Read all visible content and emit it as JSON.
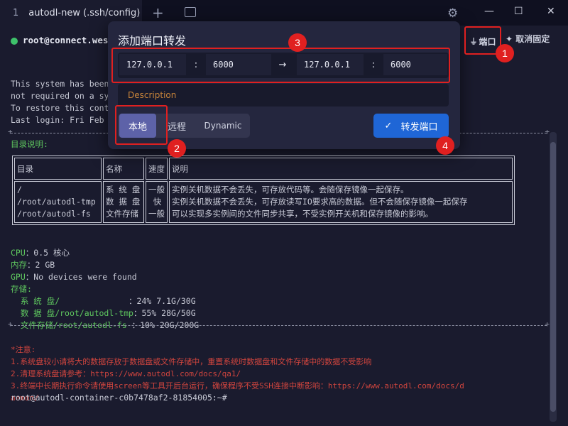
{
  "window": {
    "tab_number": "1",
    "tab_title": "autodl-new (.ssh/config)",
    "add_tab": "+",
    "minimize": "—",
    "maximize": "☐",
    "close": "✕"
  },
  "header": {
    "host": "root@connect.west",
    "port_label": "端口",
    "unpin_label": "取消固定"
  },
  "terminal": {
    "lines_top": [
      "This system has been",
      "not required on a sy",
      "",
      "To restore this cont",
      "Last login: Fri Feb"
    ],
    "dir_label": "目录说明:",
    "table": {
      "headers": [
        "目录",
        "名称",
        "速度",
        "说明"
      ],
      "dirs": "/\n/root/autodl-tmp\n/root/autodl-fs",
      "names": "系 统 盘\n数 据 盘\n文件存储",
      "speeds": "一般\n 快\n一般",
      "desc": "实例关机数据不会丢失，可存放代码等。会随保存镜像一起保存。\n实例关机数据不会丢失，可存放读写IO要求高的数据。但不会随保存镜像一起保存\n可以实现多实例间的文件同步共享，不受实例开关机和保存镜像的影响。"
    },
    "cpu_key": "CPU",
    "cpu_val": "：0.5 核心",
    "mem_key": "内存",
    "mem_val": "：2 GB",
    "gpu_key": "GPU",
    "gpu_val": "：No devices were found",
    "storage_key": "存储:",
    "storage": [
      {
        "k": "  系 统 盘/              ",
        "v": "：24% 7.1G/30G"
      },
      {
        "k": "  数 据 盘/root/autodl-tmp",
        "v": "：55% 28G/50G"
      },
      {
        "k": "  文件存储/root/autodl-fs ",
        "v": "：10% 20G/200G"
      }
    ],
    "notes": [
      "*注意:",
      "1.系统盘较小请将大的数据存放于数据盘或文件存储中，重置系统时数据盘和文件存储中的数据不受影响",
      "2.清理系统盘请参考：https://www.autodl.com/docs/qa1/",
      "3.终端中长期执行命令请使用screen等工具开后台运行，确保程序不受SSH连接中断影响：https://www.autodl.com/docs/d",
      "aemon/"
    ],
    "prompt": "root@autodl-container-c0b7478af2-81854005:~#"
  },
  "dialog": {
    "title": "添加端口转发",
    "local_host": "127.0.0.1",
    "local_port": "6000",
    "remote_host": "127.0.0.1",
    "remote_port": "6000",
    "colon": ":",
    "arrow": "→",
    "description_placeholder": "Description",
    "modes": [
      "本地",
      "远程",
      "Dynamic"
    ],
    "forward_button": "转发端口"
  },
  "annotations": [
    "1",
    "2",
    "3",
    "4"
  ]
}
